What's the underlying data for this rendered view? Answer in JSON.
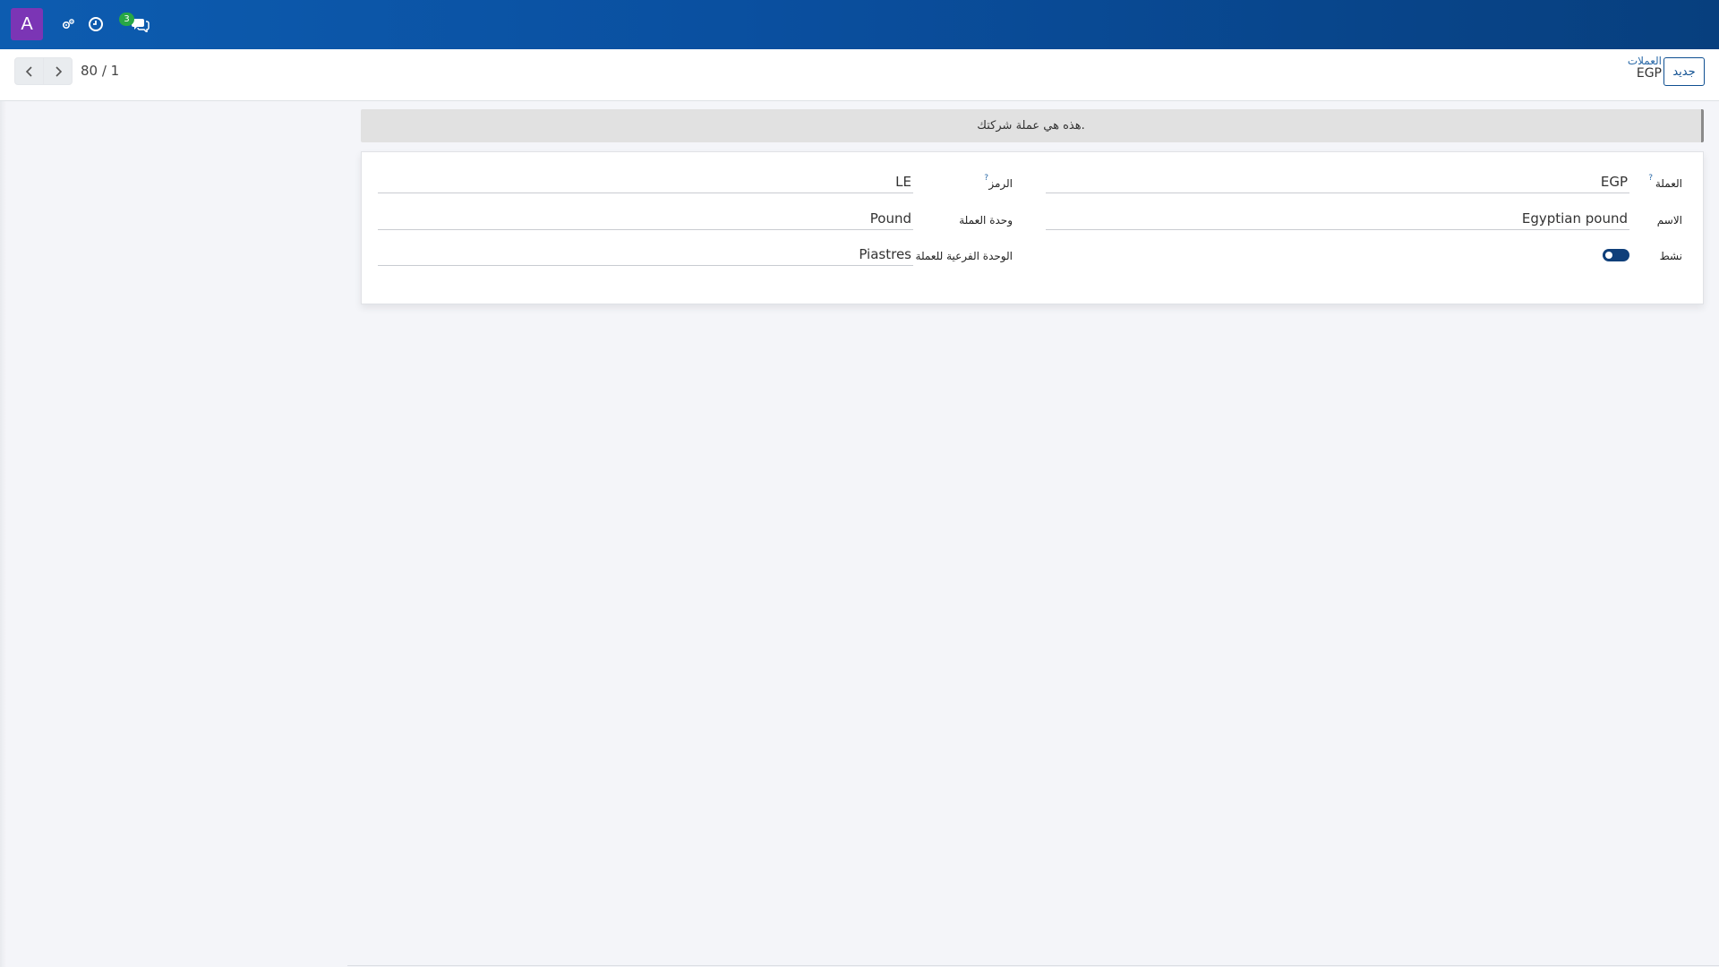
{
  "navbar": {
    "avatar_letter": "A",
    "icons": [
      "settings-gear-icon",
      "clock-icon",
      "chat-icon"
    ],
    "messages_badge": "3"
  },
  "control_panel": {
    "pager_value": "80 / 1",
    "breadcrumb_parent": "العملات",
    "breadcrumb_current": "EGP",
    "new_button_label": "جديد"
  },
  "banner": {
    "text": "هذه هي عملة شركتك."
  },
  "form": {
    "currency_label": "العملة",
    "currency_value": "EGP",
    "name_label": "الاسم",
    "name_value": "Egyptian pound",
    "active_label": "نشط",
    "active_value": true,
    "symbol_label": "الرمز",
    "symbol_value": "LE",
    "unit_label": "وحدة العملة",
    "unit_value": "Pound",
    "subunit_label": "الوحدة الفرعية للعملة",
    "subunit_value": "Piastres",
    "help_mark": "?"
  },
  "colors": {
    "navbar": "#0a4f9f",
    "avatar": "#7b35b5",
    "badge": "#28a745",
    "primary": "#0f4f91"
  }
}
